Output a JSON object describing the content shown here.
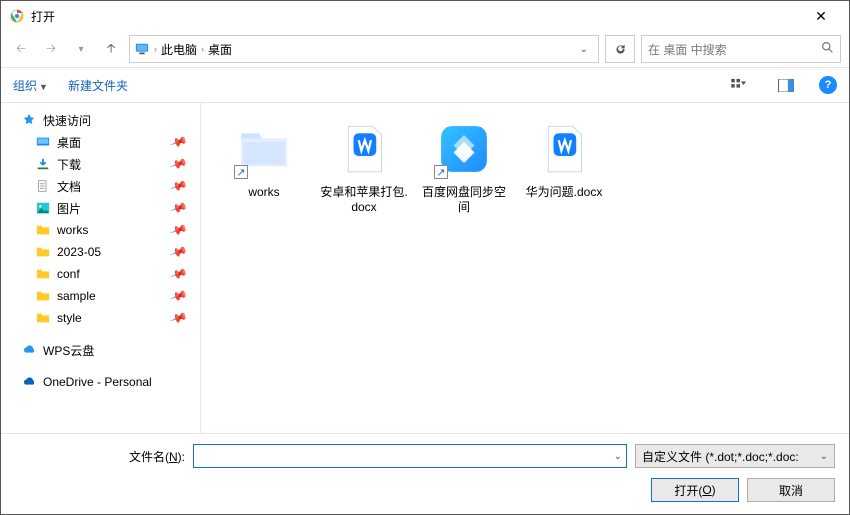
{
  "window": {
    "title": "打开"
  },
  "nav": {
    "crumb_root": "此电脑",
    "crumb_leaf": "桌面",
    "search_placeholder": "在 桌面 中搜索"
  },
  "toolbar": {
    "organize": "组织",
    "new_folder": "新建文件夹"
  },
  "sidebar": {
    "quick_access": "快速访问",
    "items": [
      {
        "label": "桌面",
        "pinned": true
      },
      {
        "label": "下载",
        "pinned": true
      },
      {
        "label": "文档",
        "pinned": true
      },
      {
        "label": "图片",
        "pinned": true
      },
      {
        "label": "works",
        "pinned": true
      },
      {
        "label": "2023-05",
        "pinned": true
      },
      {
        "label": "conf",
        "pinned": true
      },
      {
        "label": "sample",
        "pinned": true
      },
      {
        "label": "style",
        "pinned": true
      }
    ],
    "wps": "WPS云盘",
    "onedrive": "OneDrive - Personal"
  },
  "files": [
    {
      "label": "works"
    },
    {
      "label": "安卓和苹果打包.docx"
    },
    {
      "label": "百度网盘同步空间"
    },
    {
      "label": "华为问题.docx"
    }
  ],
  "footer": {
    "filename_label_pre": "文件名(",
    "filename_label_key": "N",
    "filename_label_post": "):",
    "filename_value": "",
    "filter": "自定义文件 (*.dot;*.doc;*.doc:",
    "open_pre": "打开(",
    "open_key": "O",
    "open_post": ")",
    "cancel": "取消"
  }
}
